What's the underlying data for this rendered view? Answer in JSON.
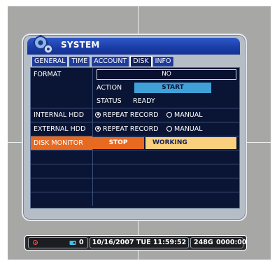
{
  "window": {
    "title": "SYSTEM"
  },
  "tabs": [
    {
      "label": "GENERAL",
      "active": false
    },
    {
      "label": "TIME",
      "active": false
    },
    {
      "label": "ACCOUNT",
      "active": false
    },
    {
      "label": "DISK",
      "active": true
    },
    {
      "label": "INFO",
      "active": false
    }
  ],
  "disk": {
    "format": {
      "label": "FORMAT",
      "value": "NO",
      "action_label": "ACTION",
      "action_button": "START",
      "status_label": "STATUS",
      "status_value": "READY"
    },
    "internal_hdd": {
      "label": "INTERNAL HDD",
      "options": [
        "REPEAT RECORD",
        "MANUAL"
      ],
      "selected": "REPEAT RECORD"
    },
    "external_hdd": {
      "label": "EXTERNAL HDD",
      "options": [
        "REPEAT RECORD",
        "MANUAL"
      ],
      "selected": "REPEAT RECORD"
    },
    "disk_monitor": {
      "label": "DISK MONITOR",
      "button": "STOP",
      "status": "WORKING"
    }
  },
  "statusbar": {
    "channel": "0",
    "datetime": "10/16/2007 TUE 11:59:52",
    "storage": "248G",
    "time2": "0000:00"
  },
  "colors": {
    "accent_orange": "#e86a20",
    "start_button": "#3fa1d8",
    "working_bg": "#fad07e",
    "panel_bg": "#0a1536"
  }
}
